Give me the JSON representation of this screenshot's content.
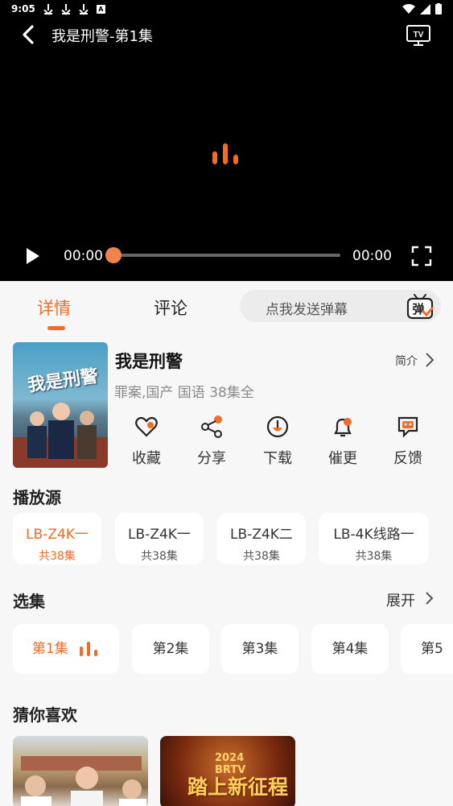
{
  "status_bar": {
    "time": "9:05",
    "notif_label": "A"
  },
  "player": {
    "title": "我是刑警-第1集",
    "current_time": "00:00",
    "total_time": "00:00",
    "progress": 0,
    "tv_label": "TV"
  },
  "tabs": [
    {
      "label": "详情",
      "active": true
    },
    {
      "label": "评论",
      "active": false
    }
  ],
  "danmu": {
    "placeholder": "点我发送弹幕",
    "icon_label": "弹"
  },
  "show": {
    "poster_title": "我是刑警",
    "title": "我是刑警",
    "intro_label": "简介",
    "meta": "罪案,国产 国语 38集全"
  },
  "actions": [
    {
      "label": "收藏",
      "icon": "heart-icon"
    },
    {
      "label": "分享",
      "icon": "share-icon"
    },
    {
      "label": "下载",
      "icon": "download-icon"
    },
    {
      "label": "催更",
      "icon": "bell-icon"
    },
    {
      "label": "反馈",
      "icon": "feedback-icon"
    }
  ],
  "sources_title": "播放源",
  "sources": [
    {
      "name": "LB-Z4K一",
      "count": "共38集",
      "active": true
    },
    {
      "name": "LB-Z4K一",
      "count": "共38集",
      "active": false
    },
    {
      "name": "LB-Z4K二",
      "count": "共38集",
      "active": false
    },
    {
      "name": "LB-4K线路一",
      "count": "共38集",
      "active": false
    }
  ],
  "episodes_title": "选集",
  "expand_label": "展开",
  "episodes": [
    {
      "label": "第1集",
      "active": true
    },
    {
      "label": "第2集",
      "active": false
    },
    {
      "label": "第3集",
      "active": false
    },
    {
      "label": "第4集",
      "active": false
    },
    {
      "label": "第5",
      "active": false
    }
  ],
  "recommend_title": "猜你喜欢",
  "recommend": [
    {
      "poster": "show-poster-1"
    },
    {
      "year": "2024",
      "channel": "BRTV",
      "title": "踏上新征程"
    }
  ],
  "colors": {
    "accent": "#f46a27",
    "player_bg": "#000000",
    "page_bg": "#f7f7f7"
  }
}
